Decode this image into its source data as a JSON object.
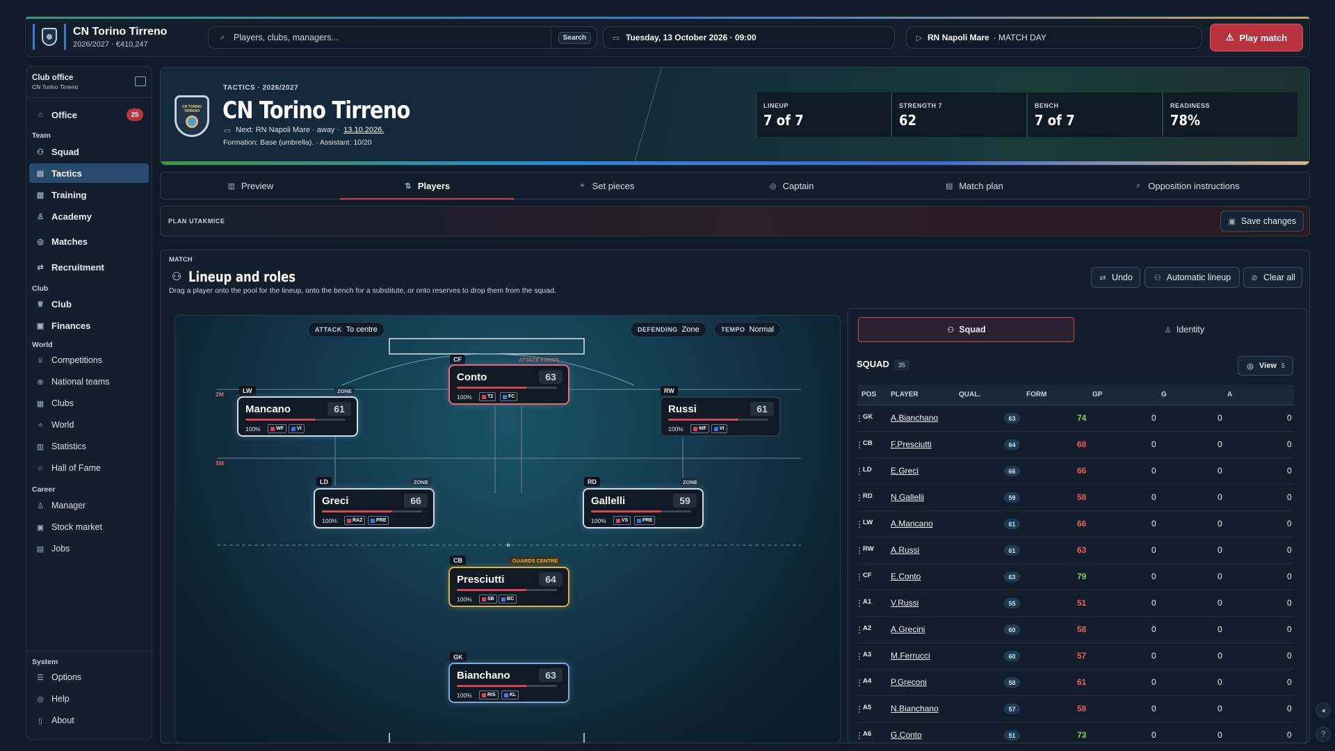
{
  "app": {
    "club_name": "CN Torino Tirreno",
    "season_budget": "2026/2027 · €410,247",
    "search_placeholder": "Players, clubs, managers...",
    "search_button": "Search",
    "date": "Tuesday, 13 October 2026 · 09:00",
    "next_opponent": "RN Napoli Mare",
    "match_day": "· MATCH DAY",
    "play_match": "Play match"
  },
  "sidebar": {
    "title": "Club office",
    "subtitle": "CN Torino Tirreno",
    "office": "Office",
    "office_badge": "25",
    "team_head": "Team",
    "squad": "Squad",
    "tactics": "Tactics",
    "training": "Training",
    "academy": "Academy",
    "matches": "Matches",
    "recruitment": "Recruitment",
    "club_head": "Club",
    "club": "Club",
    "finances": "Finances",
    "world_head": "World",
    "competitions": "Competitions",
    "national_teams": "National teams",
    "clubs": "Clubs",
    "world": "World",
    "statistics": "Statistics",
    "hall_of_fame": "Hall of Fame",
    "career_head": "Career",
    "manager": "Manager",
    "stock_market": "Stock market",
    "jobs": "Jobs",
    "system_head": "System",
    "options": "Options",
    "help": "Help",
    "about": "About"
  },
  "hero": {
    "kicker": "TACTICS · 2026/2027",
    "title": "CN Torino Tirreno",
    "next": "Next: RN Napoli Mare · away ·",
    "next_date": "13.10.2026.",
    "formation": "Formation: Base (umbrella). · Assistant: 10/20",
    "crest_text": "CN TORINO TIRRENO",
    "stats": [
      {
        "label": "LINEUP",
        "value": "7 of 7"
      },
      {
        "label": "STRENGTH 7",
        "value": "62"
      },
      {
        "label": "BENCH",
        "value": "7 of 7"
      },
      {
        "label": "READINESS",
        "value": "78%"
      }
    ]
  },
  "tabs": [
    "Preview",
    "Players",
    "Set pieces",
    "Captain",
    "Match plan",
    "Opposition instructions"
  ],
  "plan": {
    "label": "PLAN UTAKMICE",
    "save": "Save changes"
  },
  "lineup": {
    "kicker": "MATCH",
    "title": "Lineup and roles",
    "desc": "Drag a player onto the pool for the lineup, onto the bench for a substitute, or onto reserves to drop them from the squad.",
    "undo": "Undo",
    "auto": "Automatic lineup",
    "clear": "Clear all"
  },
  "pitch": {
    "attack_label": "ATTACK",
    "attack_value": "To centre",
    "defending_label": "DEFENDING",
    "defending_value": "Zone",
    "tempo_label": "TEMPO",
    "tempo_value": "Normal",
    "mark_2m": "2M",
    "mark_5m": "5M",
    "zone": "ZONE",
    "attack_focus": "ATTACK FOCUS",
    "guards_centre": "GUARDS CENTRE"
  },
  "players_on_pitch": [
    {
      "pos": "CF",
      "name": "Conto",
      "quality": "63",
      "pct": "100%",
      "t1": "T2",
      "t2": "FC",
      "condition": 0.7
    },
    {
      "pos": "LW",
      "name": "Mancano",
      "quality": "61",
      "pct": "100%",
      "t1": "WF",
      "t2": "VI",
      "condition": 0.7
    },
    {
      "pos": "RW",
      "name": "Russi",
      "quality": "61",
      "pct": "100%",
      "t1": "WF",
      "t2": "VI",
      "condition": 0.7
    },
    {
      "pos": "LD",
      "name": "Greci",
      "quality": "66",
      "pct": "100%",
      "t1": "RAZ",
      "t2": "PRE",
      "condition": 0.7
    },
    {
      "pos": "RD",
      "name": "Gallelli",
      "quality": "59",
      "pct": "100%",
      "t1": "VS",
      "t2": "PRE",
      "condition": 0.7
    },
    {
      "pos": "CB",
      "name": "Presciutti",
      "quality": "64",
      "pct": "100%",
      "t1": "SB",
      "t2": "BC",
      "condition": 0.7
    },
    {
      "pos": "GK",
      "name": "Bianchano",
      "quality": "63",
      "pct": "100%",
      "t1": "RIS",
      "t2": "KL",
      "condition": 0.7
    }
  ],
  "squad": {
    "tab_squad": "Squad",
    "tab_identity": "Identity",
    "title": "SQUAD",
    "count": "35",
    "view": "View",
    "view_count": "5",
    "columns": [
      "POS",
      "PLAYER",
      "QUAL.",
      "FORM",
      "GP",
      "G",
      "A"
    ],
    "rows": [
      {
        "pos": "GK",
        "name": "A.Bianchano",
        "qual": "63",
        "form": "74",
        "gp": "0",
        "g": "0",
        "a": "0",
        "good": true
      },
      {
        "pos": "CB",
        "name": "F.Presciutti",
        "qual": "64",
        "form": "68",
        "gp": "0",
        "g": "0",
        "a": "0",
        "good": false
      },
      {
        "pos": "LD",
        "name": "E.Greci",
        "qual": "66",
        "form": "66",
        "gp": "0",
        "g": "0",
        "a": "0",
        "good": false
      },
      {
        "pos": "RD",
        "name": "N.Gallelli",
        "qual": "59",
        "form": "58",
        "gp": "0",
        "g": "0",
        "a": "0",
        "good": false
      },
      {
        "pos": "LW",
        "name": "A.Mancano",
        "qual": "61",
        "form": "66",
        "gp": "0",
        "g": "0",
        "a": "0",
        "good": false
      },
      {
        "pos": "RW",
        "name": "A.Russi",
        "qual": "61",
        "form": "63",
        "gp": "0",
        "g": "0",
        "a": "0",
        "good": false
      },
      {
        "pos": "CF",
        "name": "E.Conto",
        "qual": "63",
        "form": "79",
        "gp": "0",
        "g": "0",
        "a": "0",
        "good": true
      },
      {
        "pos": "A1",
        "name": "V.Russi",
        "qual": "55",
        "form": "51",
        "gp": "0",
        "g": "0",
        "a": "0",
        "good": false
      },
      {
        "pos": "A2",
        "name": "A.Grecini",
        "qual": "60",
        "form": "58",
        "gp": "0",
        "g": "0",
        "a": "0",
        "good": false
      },
      {
        "pos": "A3",
        "name": "M.Ferrucci",
        "qual": "60",
        "form": "57",
        "gp": "0",
        "g": "0",
        "a": "0",
        "good": false
      },
      {
        "pos": "A4",
        "name": "P.Greconi",
        "qual": "58",
        "form": "61",
        "gp": "0",
        "g": "0",
        "a": "0",
        "good": false
      },
      {
        "pos": "A5",
        "name": "N.Bianchano",
        "qual": "57",
        "form": "58",
        "gp": "0",
        "g": "0",
        "a": "0",
        "good": false
      },
      {
        "pos": "A6",
        "name": "G.Conto",
        "qual": "51",
        "form": "73",
        "gp": "0",
        "g": "0",
        "a": "0",
        "good": true
      }
    ]
  }
}
